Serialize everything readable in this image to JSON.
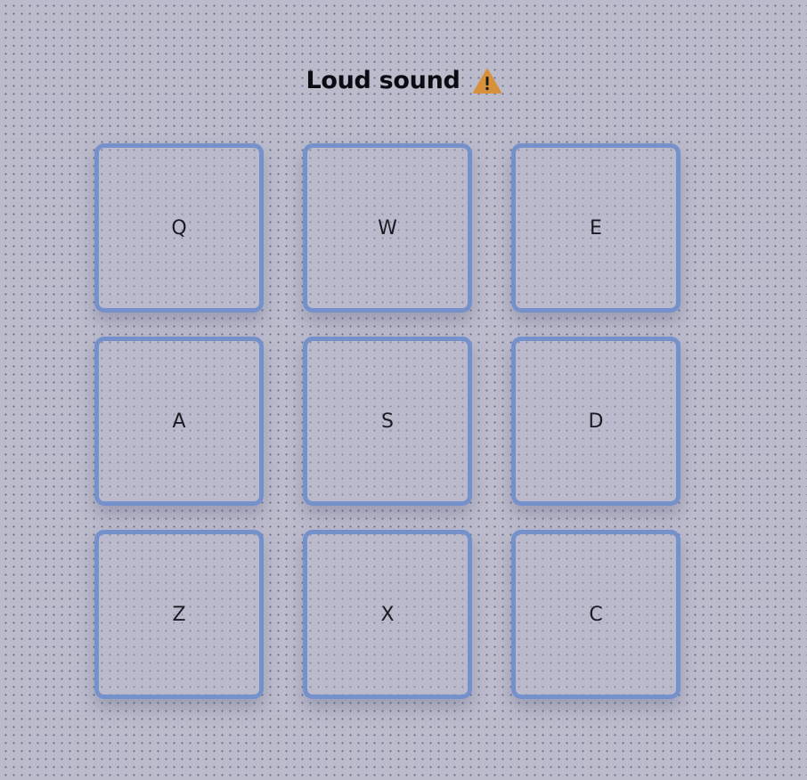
{
  "header": {
    "title": "Loud sound",
    "icon": "warning-icon",
    "icon_color": "#d6913a"
  },
  "pads": [
    {
      "key": "Q"
    },
    {
      "key": "W"
    },
    {
      "key": "E"
    },
    {
      "key": "A"
    },
    {
      "key": "S"
    },
    {
      "key": "D"
    },
    {
      "key": "Z"
    },
    {
      "key": "X"
    },
    {
      "key": "C"
    }
  ],
  "colors": {
    "background": "#bbbbcc",
    "pad_border": "#7591cc",
    "text": "#0b0b12"
  }
}
